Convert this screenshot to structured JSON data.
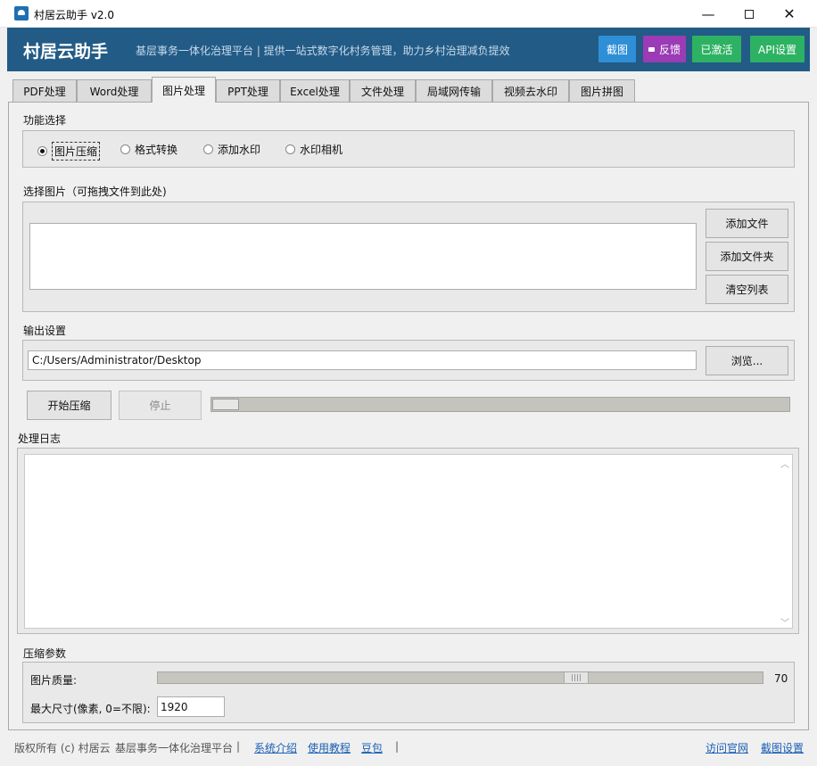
{
  "window": {
    "title": "村居云助手 v2.0",
    "minimize_glyph": "—",
    "close_glyph": "✕"
  },
  "header": {
    "brand": "村居云助手",
    "tagline": "基层事务一体化治理平台 | 提供一站式数字化村务管理，助力乡村治理减负提效",
    "buttons": {
      "screenshot": "截图",
      "feedback": "反馈",
      "activated": "已激活",
      "api": "API设置"
    }
  },
  "tabs": [
    {
      "label": "PDF处理"
    },
    {
      "label": "Word处理"
    },
    {
      "label": "图片处理"
    },
    {
      "label": "PPT处理"
    },
    {
      "label": "Excel处理"
    },
    {
      "label": "文件处理"
    },
    {
      "label": "局域网传输"
    },
    {
      "label": "视频去水印"
    },
    {
      "label": "图片拼图"
    }
  ],
  "active_tab": "图片处理",
  "function_select": {
    "label": "功能选择",
    "options": [
      "图片压缩",
      "格式转换",
      "添加水印",
      "水印相机"
    ],
    "selected": "图片压缩"
  },
  "file_select": {
    "label": "选择图片（可拖拽文件到此处)",
    "add_file": "添加文件",
    "add_folder": "添加文件夹",
    "clear_list": "清空列表"
  },
  "output": {
    "label": "输出设置",
    "path": "C:/Users/Administrator/Desktop",
    "browse": "浏览..."
  },
  "actions": {
    "start": "开始压缩",
    "stop": "停止",
    "progress_fraction": 0.0
  },
  "log": {
    "label": "处理日志",
    "scroll_up": "︿",
    "scroll_down": "﹀"
  },
  "params": {
    "label": "压缩参数",
    "quality_label": "图片质量:",
    "quality_value": "70",
    "quality_fraction": 0.7,
    "max_size_label": "最大尺寸(像素, 0=不限):",
    "max_size_value": "1920"
  },
  "footer": {
    "copyright": "版权所有 (c) 村居云",
    "platform": "基层事务一体化治理平台",
    "sep": "|",
    "links": [
      "系统介绍",
      "使用教程",
      "豆包"
    ],
    "right_links": [
      "访问官网",
      "截图设置"
    ]
  },
  "colors": {
    "header_bg": "#225b86",
    "btn_screenshot": "#2f8fd6",
    "btn_feedback": "#9b3bb5",
    "btn_green": "#2db263",
    "link": "#1a5fb4"
  }
}
